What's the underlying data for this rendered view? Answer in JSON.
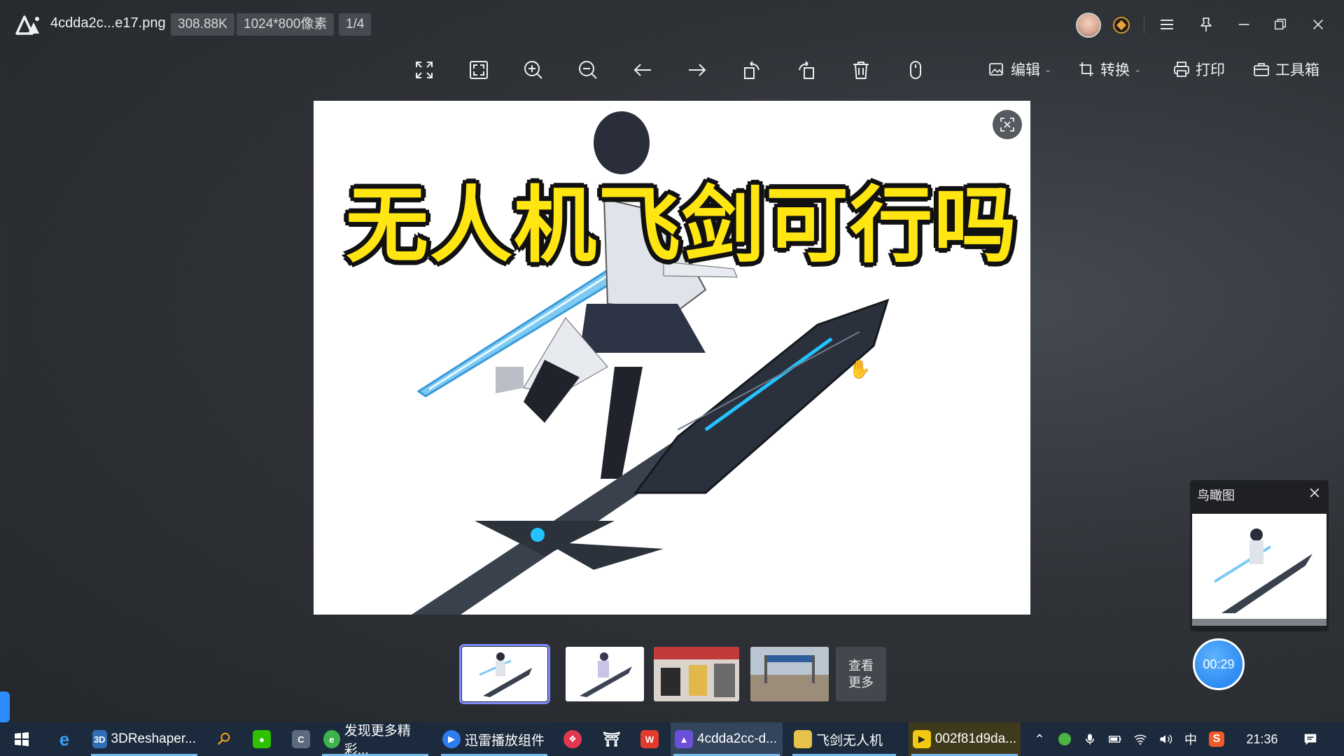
{
  "title_bar": {
    "file_name": "4cdda2c...e17.png",
    "file_size": "308.88K",
    "dimensions": "1024*800像素",
    "page_index": "1/4"
  },
  "toolbar": {
    "icons": [
      "fullscreen-icon",
      "fit-window-icon",
      "zoom-in-icon",
      "zoom-out-icon",
      "previous-icon",
      "next-icon",
      "rotate-left-icon",
      "rotate-right-icon",
      "delete-icon",
      "mouse-icon"
    ],
    "edit_label": "编辑",
    "convert_label": "转换",
    "print_label": "打印",
    "toolbox_label": "工具箱"
  },
  "image": {
    "headline": "无人机飞剑可行吗"
  },
  "thumbnails": {
    "selected_index": 0,
    "more_label_line1": "查看",
    "more_label_line2": "更多"
  },
  "overview": {
    "title": "鸟瞰图"
  },
  "timer": "00:29",
  "taskbar": {
    "items": [
      {
        "label": "3DReshaper..."
      },
      {
        "label": "发现更多精彩..."
      },
      {
        "label": "迅雷播放组件"
      },
      {
        "label": "4cdda2cc-d..."
      },
      {
        "label": "飞剑无人机"
      },
      {
        "label": "002f81d9da..."
      }
    ],
    "ime": "中",
    "clock": "21:36"
  },
  "colors": {
    "headline_fill": "#ffe512",
    "accent_blue": "#2c8cf2",
    "selected_outline": "#7d8bff",
    "taskbar_bg": "#1b2a3c"
  }
}
